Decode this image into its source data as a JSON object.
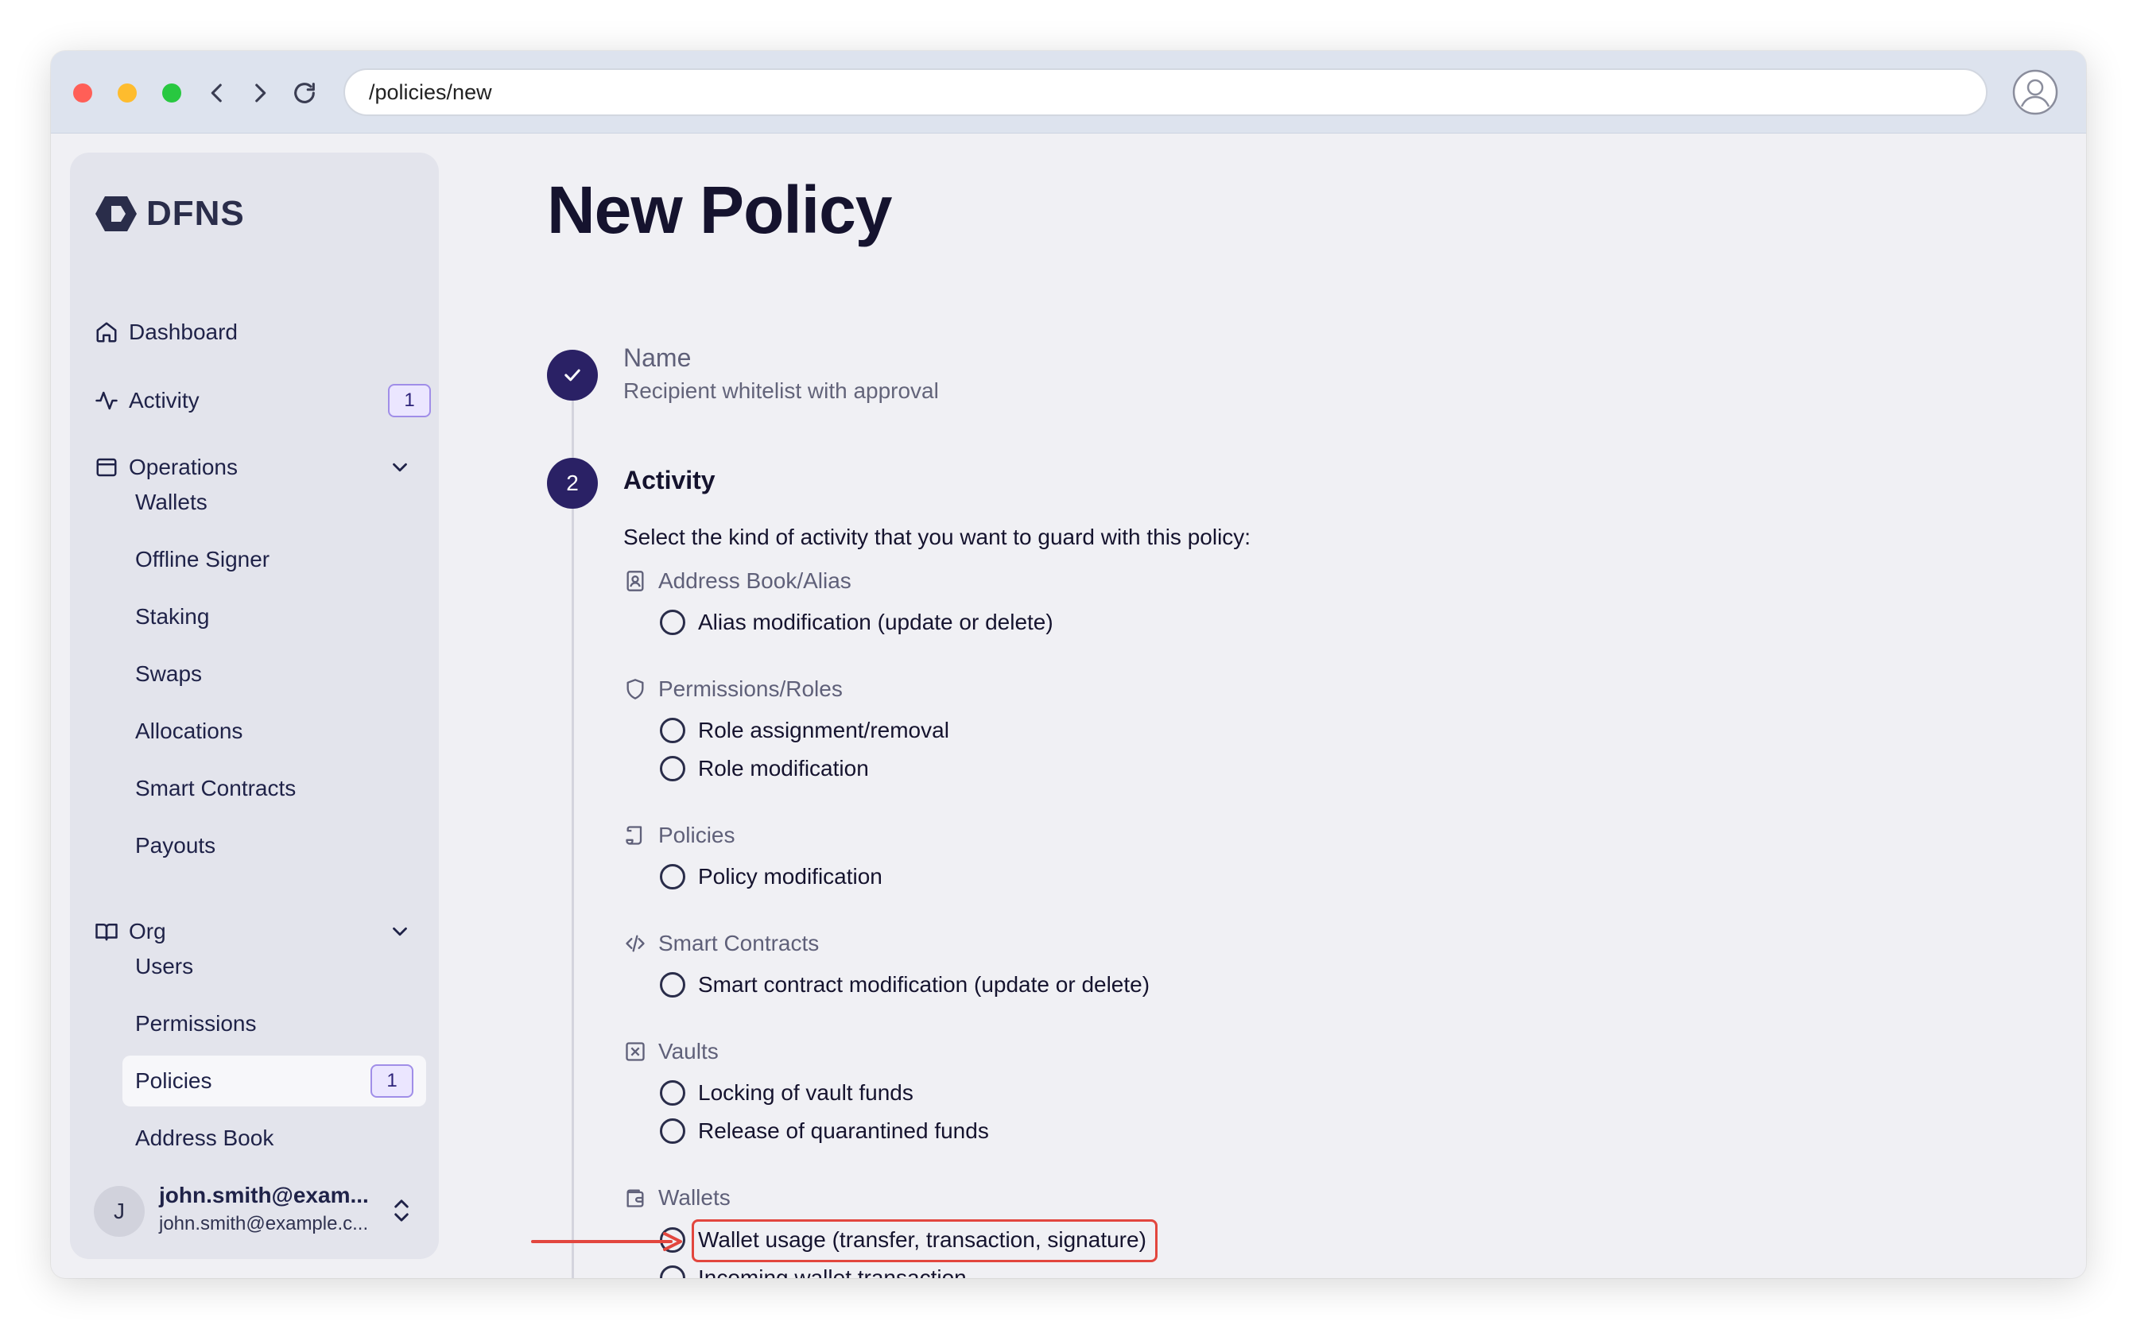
{
  "browser": {
    "url": "/policies/new"
  },
  "sidebar": {
    "brand": "DFNS",
    "nav": {
      "dashboard": "Dashboard",
      "activity": "Activity",
      "activity_badge": "1",
      "operations": "Operations",
      "org": "Org"
    },
    "operations_items": [
      "Wallets",
      "Offline Signer",
      "Staking",
      "Swaps",
      "Allocations",
      "Smart Contracts",
      "Payouts"
    ],
    "org_items": [
      "Users",
      "Permissions",
      "Policies",
      "Address Book"
    ],
    "policies_badge": "1",
    "user": {
      "initial": "J",
      "name": "john.smith@exam...",
      "email": "john.smith@example.c..."
    }
  },
  "main": {
    "title": "New Policy",
    "step1": {
      "title": "Name",
      "value": "Recipient whitelist with approval"
    },
    "step2": {
      "number": "2",
      "title": "Activity",
      "intro": "Select the kind of activity that you want to guard with this policy:"
    },
    "categories": {
      "address_book": {
        "label": "Address Book/Alias",
        "icon": "address-book-icon",
        "options": [
          "Alias modification (update or delete)"
        ]
      },
      "permissions": {
        "label": "Permissions/Roles",
        "icon": "shield-icon",
        "options": [
          "Role assignment/removal",
          "Role modification"
        ]
      },
      "policies": {
        "label": "Policies",
        "icon": "scroll-icon",
        "options": [
          "Policy modification"
        ]
      },
      "smart_contracts": {
        "label": "Smart Contracts",
        "icon": "code-icon",
        "options": [
          "Smart contract modification (update or delete)"
        ]
      },
      "vaults": {
        "label": "Vaults",
        "icon": "vault-icon",
        "options": [
          "Locking of vault funds",
          "Release of quarantined funds"
        ]
      },
      "wallets": {
        "label": "Wallets",
        "icon": "wallet-icon",
        "options": [
          "Wallet usage (transfer, transaction, signature)",
          "Incoming wallet transaction"
        ]
      }
    }
  },
  "annotation": {
    "color": "#e2463e"
  }
}
